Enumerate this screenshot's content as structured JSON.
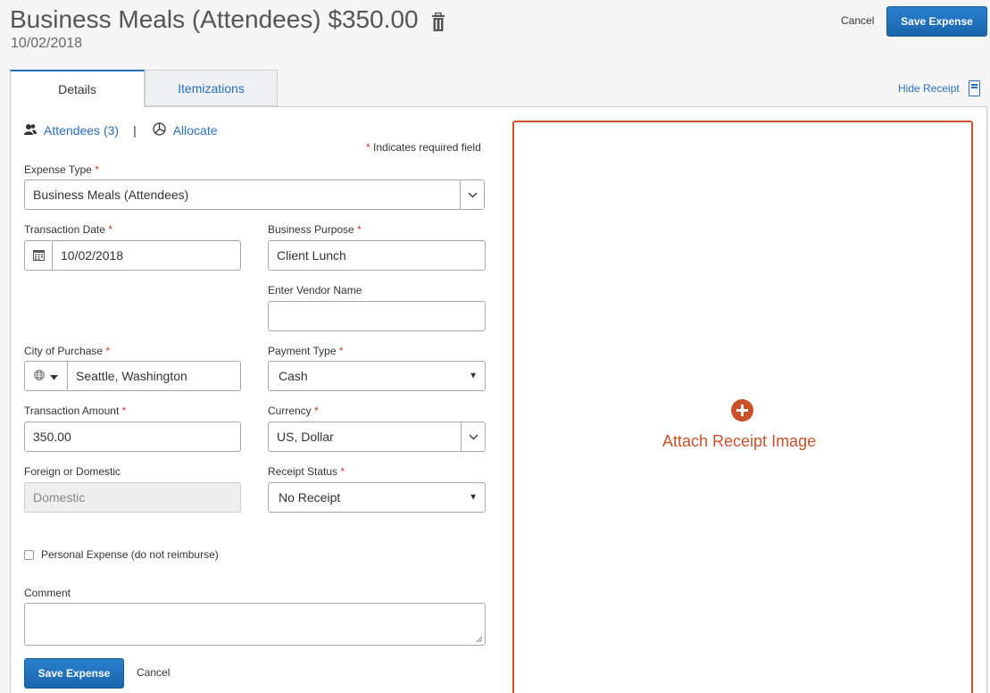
{
  "header": {
    "title": "Business Meals (Attendees) $350.00",
    "date": "10/02/2018",
    "cancel_label": "Cancel",
    "save_label": "Save Expense"
  },
  "tabs": [
    {
      "label": "Details"
    },
    {
      "label": "Itemizations"
    }
  ],
  "hide_receipt_label": "Hide Receipt",
  "links": {
    "attendees": "Attendees (3)",
    "separator": "|",
    "allocate": "Allocate"
  },
  "required_note": {
    "star": "*",
    "text": "Indicates required field"
  },
  "form": {
    "expense_type": {
      "label": "Expense Type",
      "value": "Business Meals (Attendees)"
    },
    "transaction_date": {
      "label": "Transaction Date",
      "value": "10/02/2018"
    },
    "business_purpose": {
      "label": "Business Purpose",
      "value": "Client Lunch"
    },
    "vendor_name": {
      "label": "Enter Vendor Name",
      "value": ""
    },
    "city_of_purchase": {
      "label": "City of Purchase",
      "value": "Seattle, Washington"
    },
    "payment_type": {
      "label": "Payment Type",
      "value": "Cash"
    },
    "transaction_amount": {
      "label": "Transaction Amount",
      "value": "350.00"
    },
    "currency": {
      "label": "Currency",
      "value": "US, Dollar"
    },
    "foreign_or_domestic": {
      "label": "Foreign or Domestic",
      "value": "Domestic"
    },
    "receipt_status": {
      "label": "Receipt Status",
      "value": "No Receipt"
    },
    "personal_expense": {
      "label": "Personal Expense (do not reimburse)",
      "checked": false
    },
    "comment": {
      "label": "Comment",
      "value": ""
    }
  },
  "footer": {
    "save_label": "Save Expense",
    "cancel_label": "Cancel"
  },
  "receipt": {
    "attach_label": "Attach Receipt Image"
  },
  "colors": {
    "primary": "#1f6fb8",
    "link": "#2a6ebb",
    "required": "#c23b30",
    "receipt_accent": "#c9502a"
  }
}
